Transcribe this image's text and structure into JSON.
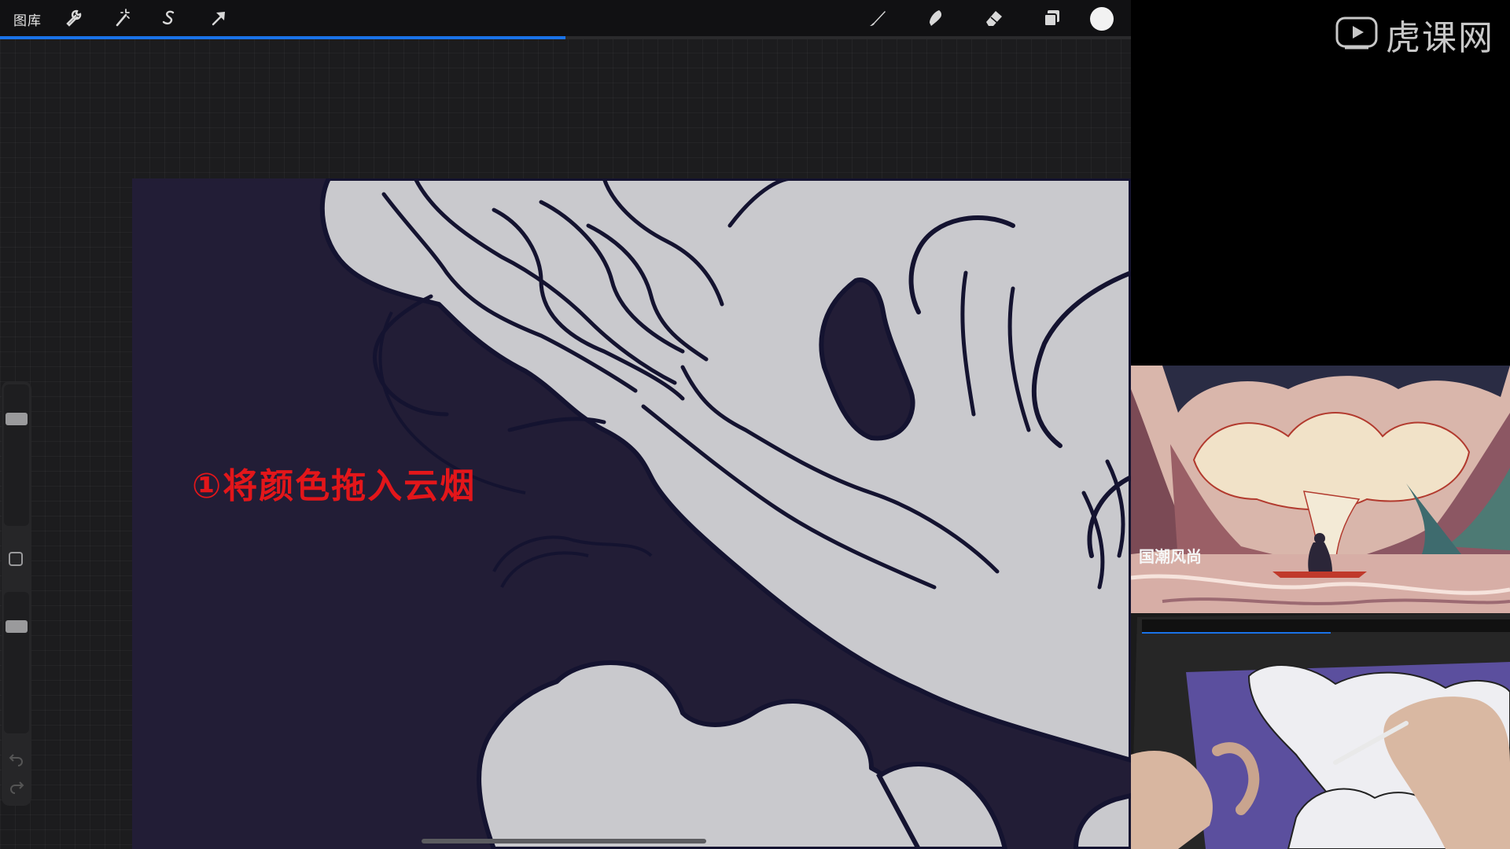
{
  "toolbar": {
    "gallery_label": "图库",
    "left_icons": [
      "wrench-icon",
      "magic-wand-icon",
      "selection-icon",
      "transform-arrow-icon"
    ],
    "right_icons": [
      "brush-icon",
      "smudge-icon",
      "eraser-icon",
      "layers-icon",
      "color-picker-icon"
    ],
    "selected_color": "#f2f2f2"
  },
  "progress": {
    "value": 0.5,
    "color": "#1a73e8"
  },
  "sidebar": {
    "brush_size_level": 0.22,
    "opacity_level": 0.22,
    "icons": [
      "modify-square-icon",
      "undo-icon",
      "redo-icon"
    ]
  },
  "canvas": {
    "background_color": "#221d36",
    "cloud_color": "#c9c9cd",
    "line_color": "#141330"
  },
  "annotation": {
    "text": "①将颜色拖入云烟",
    "color": "#e3161a"
  },
  "watermark": {
    "text": "虎课网"
  },
  "reference_image": {
    "title_chars": "国潮风尚"
  }
}
